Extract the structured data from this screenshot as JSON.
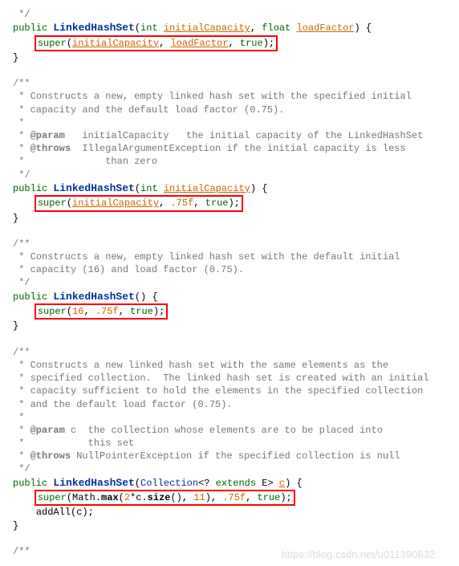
{
  "block1": {
    "comment_end": " */",
    "sig_pre": "public ",
    "sig_name": "LinkedHashSet",
    "sig_open": "(",
    "p1_type": "int",
    "p1_name": "initialCapacity",
    "sig_sep": ", ",
    "p2_type": "float",
    "p2_name": "loadFactor",
    "sig_close": ") {",
    "call_super": "super",
    "call_open": "(",
    "call_arg1": "initialCapacity",
    "call_sep1": ", ",
    "call_arg2": "loadFactor",
    "call_sep2": ", ",
    "call_true": "true",
    "call_close": ");",
    "brace": "}"
  },
  "block2": {
    "c1": "/**",
    "c2": " * Constructs a new, empty linked hash set with the specified initial",
    "c3": " * capacity and the default load factor (0.75).",
    "c4": " *",
    "c5_pre": " * ",
    "c5_tag": "@param",
    "c5_txt": "   initialCapacity   the initial capacity of the LinkedHashSet",
    "c6_pre": " * ",
    "c6_tag": "@throws",
    "c6_txt": "  IllegalArgumentException if the initial capacity is less",
    "c7": " *              than zero",
    "c8": " */",
    "sig_pre": "public ",
    "sig_name": "LinkedHashSet",
    "sig_open": "(",
    "p1_type": "int",
    "p1_name": "initialCapacity",
    "sig_close": ") {",
    "call_super": "super",
    "call_open": "(",
    "call_arg1": "initialCapacity",
    "call_sep1": ", ",
    "call_arg2": ".75f",
    "call_sep2": ", ",
    "call_true": "true",
    "call_close": ");",
    "brace": "}"
  },
  "block3": {
    "c1": "/**",
    "c2": " * Constructs a new, empty linked hash set with the default initial",
    "c3": " * capacity (16) and load factor (0.75).",
    "c4": " */",
    "sig_pre": "public ",
    "sig_name": "LinkedHashSet",
    "sig_open": "(",
    "sig_close": ") {",
    "call_super": "super",
    "call_open": "(",
    "call_arg1": "16",
    "call_sep1": ", ",
    "call_arg2": ".75f",
    "call_sep2": ", ",
    "call_true": "true",
    "call_close": ");",
    "brace": "}"
  },
  "block4": {
    "c1": "/**",
    "c2": " * Constructs a new linked hash set with the same elements as the",
    "c3": " * specified collection.  The linked hash set is created with an initial",
    "c4": " * capacity sufficient to hold the elements in the specified collection",
    "c5": " * and the default load factor (0.75).",
    "c6": " *",
    "c7_pre": " * ",
    "c7_tag": "@param",
    "c7_txt": " c  the collection whose elements are to be placed into",
    "c8": " *           this set",
    "c9_pre": " * ",
    "c9_tag": "@throws",
    "c9_txt": " NullPointerException if the specified collection is null",
    "c10": " */",
    "sig_pre": "public ",
    "sig_name": "LinkedHashSet",
    "sig_open": "(",
    "p1_type": "Collection",
    "p1_gen": "<? ",
    "p1_ext": "extends",
    "p1_gen2": " E> ",
    "p1_name": "c",
    "sig_close": ") {",
    "call_super": "super",
    "call_open": "(Math.",
    "call_max": "max",
    "call_maxopen": "(",
    "call_maxarg1": "2",
    "call_maxstar": "*c.",
    "call_size": "size",
    "call_sizecall": "(), ",
    "call_maxarg2": "11",
    "call_maxclose": "), ",
    "call_arg2": ".75f",
    "call_sep2": ", ",
    "call_true": "true",
    "call_close": ");",
    "addall": "addAll(c);",
    "brace": "}"
  },
  "tail": {
    "c1": "/**"
  },
  "watermark": "https://blog.csdn.net/u011390632"
}
